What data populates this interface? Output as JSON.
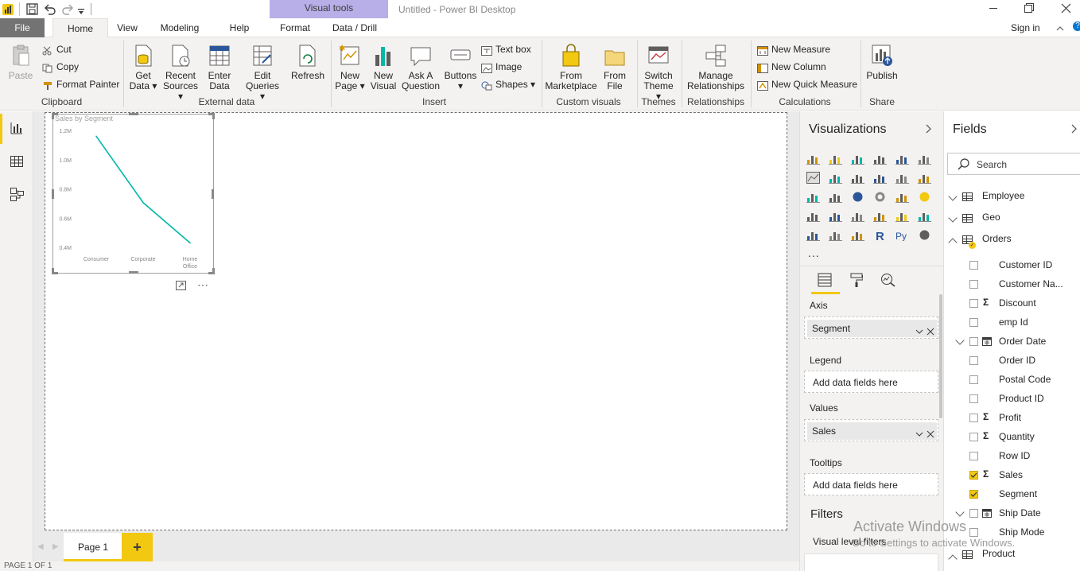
{
  "window": {
    "title": "Untitled - Power BI Desktop",
    "context_tab": "Visual tools",
    "sign_in": "Sign in"
  },
  "tabs": [
    "File",
    "Home",
    "View",
    "Modeling",
    "Help",
    "Format",
    "Data / Drill"
  ],
  "ribbon": {
    "clipboard": {
      "paste": "Paste",
      "cut": "Cut",
      "copy": "Copy",
      "format_painter": "Format Painter",
      "label": "Clipboard"
    },
    "external": {
      "get_data": [
        "Get",
        "Data"
      ],
      "recent": [
        "Recent",
        "Sources"
      ],
      "enter": [
        "Enter",
        "Data"
      ],
      "edit": [
        "Edit",
        "Queries"
      ],
      "refresh": "Refresh",
      "label": "External data"
    },
    "insert": {
      "new_page": [
        "New",
        "Page"
      ],
      "new_visual": [
        "New",
        "Visual"
      ],
      "ask": [
        "Ask A",
        "Question"
      ],
      "buttons": "Buttons",
      "text_box": "Text box",
      "image": "Image",
      "shapes": "Shapes",
      "label": "Insert"
    },
    "custom": {
      "marketplace": [
        "From",
        "Marketplace"
      ],
      "file": [
        "From",
        "File"
      ],
      "label": "Custom visuals"
    },
    "themes": {
      "switch": [
        "Switch",
        "Theme"
      ],
      "label": "Themes"
    },
    "relationships": {
      "manage": [
        "Manage",
        "Relationships"
      ],
      "label": "Relationships"
    },
    "calculations": {
      "new_measure": "New Measure",
      "new_column": "New Column",
      "new_quick_measure": "New Quick Measure",
      "label": "Calculations"
    },
    "share": {
      "publish": "Publish",
      "label": "Share"
    }
  },
  "chart_data": {
    "type": "line",
    "title": "Sales by Segment",
    "categories": [
      "Consumer",
      "Corporate",
      "Home Office"
    ],
    "category_labels": [
      [
        "Consumer"
      ],
      [
        "Corporate"
      ],
      [
        "Home",
        "Office"
      ]
    ],
    "values": [
      1160000,
      706000,
      430000
    ],
    "y_ticks": [
      "1.2M",
      "1.0M",
      "0.8M",
      "0.6M",
      "0.4M"
    ],
    "ylim": [
      400000,
      1200000
    ],
    "color": "#01b8aa"
  },
  "visualizations": {
    "title": "Visualizations",
    "more": "...",
    "wells": {
      "axis": {
        "label": "Axis",
        "value": "Segment"
      },
      "legend": {
        "label": "Legend",
        "placeholder": "Add data fields here"
      },
      "values": {
        "label": "Values",
        "value": "Sales"
      },
      "tooltips": {
        "label": "Tooltips",
        "placeholder": "Add data fields here"
      }
    },
    "filters": {
      "title": "Filters",
      "visual_level": "Visual level filters"
    }
  },
  "fields": {
    "title": "Fields",
    "search_placeholder": "Search",
    "tables": [
      {
        "name": "Employee"
      },
      {
        "name": "Geo"
      },
      {
        "name": "Orders"
      }
    ],
    "order_fields": [
      {
        "name": "Customer ID",
        "checked": false,
        "icon": ""
      },
      {
        "name": "Customer Na...",
        "checked": false,
        "icon": ""
      },
      {
        "name": "Discount",
        "checked": false,
        "icon": "sigma"
      },
      {
        "name": "emp Id",
        "checked": false,
        "icon": ""
      },
      {
        "name": "Order Date",
        "checked": false,
        "icon": "calendar"
      },
      {
        "name": "Order ID",
        "checked": false,
        "icon": ""
      },
      {
        "name": "Postal Code",
        "checked": false,
        "icon": ""
      },
      {
        "name": "Product ID",
        "checked": false,
        "icon": ""
      },
      {
        "name": "Profit",
        "checked": false,
        "icon": "sigma"
      },
      {
        "name": "Quantity",
        "checked": false,
        "icon": "sigma"
      },
      {
        "name": "Row ID",
        "checked": false,
        "icon": ""
      },
      {
        "name": "Sales",
        "checked": true,
        "icon": "sigma"
      },
      {
        "name": "Segment",
        "checked": true,
        "icon": ""
      },
      {
        "name": "Ship Date",
        "checked": false,
        "icon": "calendar"
      },
      {
        "name": "Ship Mode",
        "checked": false,
        "icon": ""
      }
    ],
    "product": "Product"
  },
  "watermark": {
    "line1": "Activate Windows",
    "line2": "Go to Settings to activate Windows."
  },
  "pages": {
    "tab": "Page 1",
    "add": "+"
  },
  "status": "PAGE 1 OF 1",
  "colors": {
    "accent": "#f2c811",
    "chart_line": "#01b8aa",
    "file_tab": "#737373"
  }
}
